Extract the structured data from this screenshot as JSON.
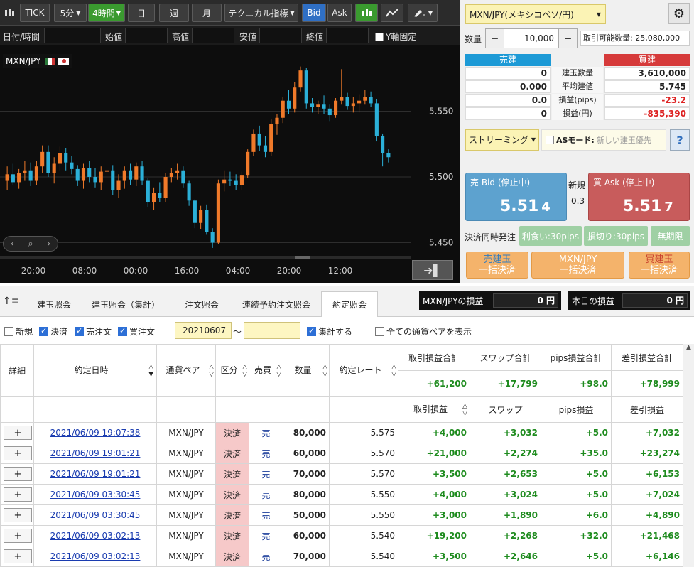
{
  "toolbar": {
    "tick": "TICK",
    "interval": "5分",
    "active_interval": "4時間",
    "day": "日",
    "week": "週",
    "month": "月",
    "indicators": "テクニカル指標",
    "bid": "Bid",
    "ask": "Ask"
  },
  "ohlc_bar": {
    "datetime": "日付/時間",
    "open": "始値",
    "high": "高値",
    "low": "安値",
    "close": "終値",
    "y_lock": "Y軸固定"
  },
  "chart": {
    "symbol": "MXN/JPY",
    "y_ticks": [
      "5.550",
      "5.500",
      "5.450"
    ],
    "x_ticks": [
      "20:00",
      "08:00",
      "00:00",
      "16:00",
      "04:00",
      "20:00",
      "12:00"
    ],
    "colors": {
      "up": "#f07a2a",
      "down": "#2bb0d8"
    }
  },
  "chart_data": {
    "type": "candlestick",
    "title": "MXN/JPY",
    "ylim": [
      5.44,
      5.6
    ],
    "y_ticks": [
      5.45,
      5.5,
      5.55
    ],
    "candles": [
      [
        5.497,
        5.508,
        5.49,
        5.502
      ],
      [
        5.502,
        5.51,
        5.494,
        5.496
      ],
      [
        5.496,
        5.506,
        5.491,
        5.503
      ],
      [
        5.503,
        5.512,
        5.497,
        5.505
      ],
      [
        5.505,
        5.511,
        5.493,
        5.497
      ],
      [
        5.497,
        5.512,
        5.494,
        5.508
      ],
      [
        5.508,
        5.524,
        5.503,
        5.519
      ],
      [
        5.519,
        5.524,
        5.5,
        5.503
      ],
      [
        5.503,
        5.515,
        5.495,
        5.51
      ],
      [
        5.51,
        5.523,
        5.505,
        5.518
      ],
      [
        5.518,
        5.522,
        5.505,
        5.511
      ],
      [
        5.511,
        5.516,
        5.502,
        5.506
      ],
      [
        5.506,
        5.509,
        5.493,
        5.497
      ],
      [
        5.497,
        5.51,
        5.491,
        5.507
      ],
      [
        5.507,
        5.512,
        5.496,
        5.5
      ],
      [
        5.5,
        5.507,
        5.492,
        5.496
      ],
      [
        5.496,
        5.508,
        5.49,
        5.504
      ],
      [
        5.504,
        5.512,
        5.498,
        5.505
      ],
      [
        5.505,
        5.509,
        5.486,
        5.49
      ],
      [
        5.49,
        5.502,
        5.484,
        5.497
      ],
      [
        5.497,
        5.508,
        5.491,
        5.505
      ],
      [
        5.505,
        5.51,
        5.494,
        5.498
      ],
      [
        5.498,
        5.511,
        5.493,
        5.508
      ],
      [
        5.508,
        5.512,
        5.494,
        5.497
      ],
      [
        5.497,
        5.499,
        5.477,
        5.481
      ],
      [
        5.481,
        5.492,
        5.475,
        5.488
      ],
      [
        5.488,
        5.496,
        5.481,
        5.484
      ],
      [
        5.484,
        5.503,
        5.481,
        5.5
      ],
      [
        5.5,
        5.507,
        5.496,
        5.503
      ],
      [
        5.503,
        5.51,
        5.498,
        5.505
      ],
      [
        5.505,
        5.508,
        5.492,
        5.495
      ],
      [
        5.495,
        5.497,
        5.478,
        5.482
      ],
      [
        5.482,
        5.483,
        5.461,
        5.465
      ],
      [
        5.465,
        5.478,
        5.46,
        5.475
      ],
      [
        5.475,
        5.479,
        5.456,
        5.458
      ],
      [
        5.458,
        5.461,
        5.446,
        5.45
      ],
      [
        5.45,
        5.498,
        5.449,
        5.495
      ],
      [
        5.495,
        5.505,
        5.489,
        5.498
      ],
      [
        5.498,
        5.504,
        5.493,
        5.497
      ],
      [
        5.497,
        5.502,
        5.49,
        5.494
      ],
      [
        5.494,
        5.504,
        5.49,
        5.501
      ],
      [
        5.501,
        5.521,
        5.499,
        5.519
      ],
      [
        5.519,
        5.536,
        5.516,
        5.533
      ],
      [
        5.533,
        5.539,
        5.52,
        5.524
      ],
      [
        5.524,
        5.531,
        5.515,
        5.519
      ],
      [
        5.519,
        5.544,
        5.516,
        5.54
      ],
      [
        5.54,
        5.548,
        5.532,
        5.545
      ],
      [
        5.545,
        5.561,
        5.541,
        5.558
      ],
      [
        5.558,
        5.566,
        5.548,
        5.552
      ],
      [
        5.552,
        5.572,
        5.549,
        5.568
      ],
      [
        5.568,
        5.584,
        5.565,
        5.581
      ],
      [
        5.581,
        5.583,
        5.552,
        5.556
      ],
      [
        5.556,
        5.56,
        5.549,
        5.553
      ],
      [
        5.553,
        5.558,
        5.548,
        5.555
      ],
      [
        5.555,
        5.562,
        5.548,
        5.552
      ],
      [
        5.552,
        5.555,
        5.542,
        5.547
      ],
      [
        5.547,
        5.56,
        5.545,
        5.558
      ],
      [
        5.558,
        5.582,
        5.555,
        5.561
      ],
      [
        5.561,
        5.564,
        5.551,
        5.554
      ],
      [
        5.554,
        5.561,
        5.549,
        5.556
      ],
      [
        5.556,
        5.563,
        5.549,
        5.558
      ],
      [
        5.558,
        5.566,
        5.555,
        5.561
      ],
      [
        5.561,
        5.565,
        5.553,
        5.556
      ],
      [
        5.556,
        5.559,
        5.527,
        5.531
      ],
      [
        5.531,
        5.533,
        5.508,
        5.518
      ],
      [
        5.518,
        5.521,
        5.511,
        5.515
      ]
    ]
  },
  "trade_panel": {
    "pair_select": "MXN/JPY(メキシコペソ/円)",
    "qty_label": "数量",
    "qty_minus": "－",
    "qty_value": "10,000",
    "qty_plus": "＋",
    "available": "取引可能数量: 25,080,000",
    "sell_header": "売建",
    "buy_header": "買建",
    "rows": [
      {
        "label": "建玉数量",
        "sell": "0",
        "buy": "3,610,000"
      },
      {
        "label": "平均建値",
        "sell": "0.000",
        "buy": "5.745"
      },
      {
        "label": "損益(pips)",
        "sell": "0.0",
        "buy": "-23.2"
      },
      {
        "label": "損益(円)",
        "sell": "0",
        "buy": "-835,390"
      }
    ],
    "streaming": "ストリーミング",
    "as_mode": "ASモード:",
    "as_mode_placeholder": "新しい建玉優先",
    "help": "?",
    "bid_label": "売 Bid (停止中)",
    "bid_big": "5.51",
    "bid_small": "4",
    "ask_label": "買 Ask (停止中)",
    "ask_big": "5.51",
    "ask_small": "7",
    "new_label": "新規",
    "spread": "0.3",
    "settle_label": "決済同時発注",
    "profit_btn": "利食い:30pips",
    "loss_btn": "損切り:30pips",
    "no_limit_btn": "無期限",
    "close_sell": [
      "売建玉",
      "一括決済"
    ],
    "close_pair": [
      "MXN/JPY",
      "一括決済"
    ],
    "close_buy": [
      "買建玉",
      "一括決済"
    ]
  },
  "tabs": {
    "items": [
      "建玉照会",
      "建玉照会（集計）",
      "注文照会",
      "連続予約注文照会",
      "約定照会"
    ],
    "pnl_pair_label": "MXN/JPYの損益",
    "pnl_pair_value": "0 円",
    "pnl_today_label": "本日の損益",
    "pnl_today_value": "0 円"
  },
  "filters": {
    "new": "新規",
    "settle": "決済",
    "sell_order": "売注文",
    "buy_order": "買注文",
    "date_from": "20210607",
    "tilde": "～",
    "aggregate": "集計する",
    "show_all": "全ての通貨ペアを表示"
  },
  "table": {
    "headers": [
      "詳細",
      "約定日時",
      "通貨ペア",
      "区分",
      "売買",
      "数量",
      "約定レート"
    ],
    "sum_headers": [
      "取引損益合計",
      "スワップ合計",
      "pips損益合計",
      "差引損益合計"
    ],
    "sum_values": [
      "+61,200",
      "+17,799",
      "+98.0",
      "+78,999"
    ],
    "sub_headers": [
      "取引損益",
      "スワップ",
      "pips損益",
      "差引損益"
    ],
    "rows": [
      {
        "time": "2021/06/09 19:07:38",
        "pair": "MXN/JPY",
        "type": "決済",
        "side": "売",
        "qty": "80,000",
        "rate": "5.575",
        "pl": "+4,000",
        "swap": "+3,032",
        "pips": "+5.0",
        "net": "+7,032"
      },
      {
        "time": "2021/06/09 19:01:21",
        "pair": "MXN/JPY",
        "type": "決済",
        "side": "売",
        "qty": "60,000",
        "rate": "5.570",
        "pl": "+21,000",
        "swap": "+2,274",
        "pips": "+35.0",
        "net": "+23,274"
      },
      {
        "time": "2021/06/09 19:01:21",
        "pair": "MXN/JPY",
        "type": "決済",
        "side": "売",
        "qty": "70,000",
        "rate": "5.570",
        "pl": "+3,500",
        "swap": "+2,653",
        "pips": "+5.0",
        "net": "+6,153"
      },
      {
        "time": "2021/06/09 03:30:45",
        "pair": "MXN/JPY",
        "type": "決済",
        "side": "売",
        "qty": "80,000",
        "rate": "5.550",
        "pl": "+4,000",
        "swap": "+3,024",
        "pips": "+5.0",
        "net": "+7,024"
      },
      {
        "time": "2021/06/09 03:30:45",
        "pair": "MXN/JPY",
        "type": "決済",
        "side": "売",
        "qty": "50,000",
        "rate": "5.550",
        "pl": "+3,000",
        "swap": "+1,890",
        "pips": "+6.0",
        "net": "+4,890"
      },
      {
        "time": "2021/06/09 03:02:13",
        "pair": "MXN/JPY",
        "type": "決済",
        "side": "売",
        "qty": "60,000",
        "rate": "5.540",
        "pl": "+19,200",
        "swap": "+2,268",
        "pips": "+32.0",
        "net": "+21,468"
      },
      {
        "time": "2021/06/09 03:02:13",
        "pair": "MXN/JPY",
        "type": "決済",
        "side": "売",
        "qty": "70,000",
        "rate": "5.540",
        "pl": "+3,500",
        "swap": "+2,646",
        "pips": "+5.0",
        "net": "+6,146"
      }
    ],
    "detail_btn": "+"
  }
}
